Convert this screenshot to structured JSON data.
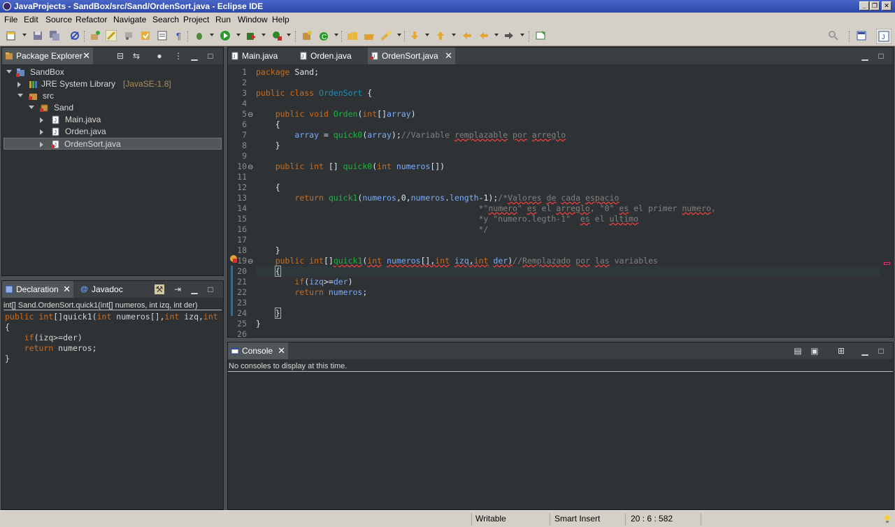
{
  "window": {
    "title": "JavaProjects - SandBox/src/Sand/OrdenSort.java - Eclipse IDE",
    "controls": [
      "_",
      "❐",
      "✕"
    ]
  },
  "menu": [
    "File",
    "Edit",
    "Source",
    "Refactor",
    "Navigate",
    "Search",
    "Project",
    "Run",
    "Window",
    "Help"
  ],
  "package_explorer": {
    "tab": "Package Explorer",
    "tree": [
      {
        "label": "SandBox",
        "deco": ""
      },
      {
        "label": "JRE System Library",
        "deco": "[JavaSE-1.8]"
      },
      {
        "label": "src",
        "deco": ""
      },
      {
        "label": "Sand",
        "deco": ""
      },
      {
        "label": "Main.java",
        "deco": ""
      },
      {
        "label": "Orden.java",
        "deco": ""
      },
      {
        "label": "OrdenSort.java",
        "deco": ""
      }
    ]
  },
  "declaration": {
    "tabs": [
      "Declaration",
      "Javadoc"
    ],
    "signature": "int[] Sand.OrdenSort.quick1(int[] numeros, int izq, int der)",
    "code": [
      "public int[]quick1(int numeros[],int izq,int",
      "{",
      "    if(izq>=der)",
      "    return numeros;",
      "",
      "}"
    ]
  },
  "editor": {
    "tabs": [
      "Main.java",
      "Orden.java",
      "OrdenSort.java"
    ],
    "active_tab": "OrdenSort.java",
    "line_numbers": [
      "1",
      "2",
      "3",
      "4",
      "5",
      "6",
      "7",
      "8",
      "9",
      "10",
      "11",
      "12",
      "13",
      "14",
      "15",
      "16",
      "17",
      "18",
      "19",
      "20",
      "21",
      "22",
      "23",
      "24",
      "25",
      "26"
    ],
    "code": [
      "package Sand;",
      "",
      "public class OrdenSort {",
      "",
      "    public void Orden(int[]array)",
      "    {",
      "        array = quick0(array);//Variable remplazable por arreglo",
      "    }",
      "",
      "    public int [] quick0(int numeros[])",
      "",
      "    {",
      "        return quick1(numeros,0,numeros.length-1);/*Valores de cada espacio",
      "                                              *\"numero\" es el arreglo, \"0\" es el primer numero,",
      "                                              *y \"numero.legth-1\"  es el ultimo",
      "                                              */",
      "",
      "    }",
      "    public int[]quick1(int numeros[],int izq,int der)//Remplazado por las variables",
      "    {",
      "        if(izq>=der)",
      "        return numeros;",
      "",
      "    }",
      "}",
      ""
    ]
  },
  "console": {
    "tab": "Console",
    "message": "No consoles to display at this time."
  },
  "status": {
    "writable": "Writable",
    "insert_mode": "Smart Insert",
    "position": "20 : 6 : 582"
  },
  "colors": {
    "keyword": "#cc6c1d",
    "method": "#1eb540",
    "variable": "#79abff",
    "comment": "#808080",
    "type": "#1290c3"
  }
}
